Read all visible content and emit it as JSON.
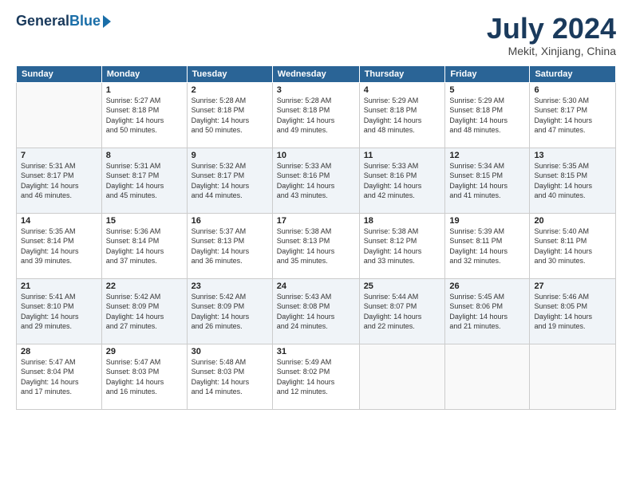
{
  "header": {
    "logo_general": "General",
    "logo_blue": "Blue",
    "month_title": "July 2024",
    "location": "Mekit, Xinjiang, China"
  },
  "weekdays": [
    "Sunday",
    "Monday",
    "Tuesday",
    "Wednesday",
    "Thursday",
    "Friday",
    "Saturday"
  ],
  "weeks": [
    [
      {
        "day": "",
        "info": ""
      },
      {
        "day": "1",
        "info": "Sunrise: 5:27 AM\nSunset: 8:18 PM\nDaylight: 14 hours\nand 50 minutes."
      },
      {
        "day": "2",
        "info": "Sunrise: 5:28 AM\nSunset: 8:18 PM\nDaylight: 14 hours\nand 50 minutes."
      },
      {
        "day": "3",
        "info": "Sunrise: 5:28 AM\nSunset: 8:18 PM\nDaylight: 14 hours\nand 49 minutes."
      },
      {
        "day": "4",
        "info": "Sunrise: 5:29 AM\nSunset: 8:18 PM\nDaylight: 14 hours\nand 48 minutes."
      },
      {
        "day": "5",
        "info": "Sunrise: 5:29 AM\nSunset: 8:18 PM\nDaylight: 14 hours\nand 48 minutes."
      },
      {
        "day": "6",
        "info": "Sunrise: 5:30 AM\nSunset: 8:17 PM\nDaylight: 14 hours\nand 47 minutes."
      }
    ],
    [
      {
        "day": "7",
        "info": "Sunrise: 5:31 AM\nSunset: 8:17 PM\nDaylight: 14 hours\nand 46 minutes."
      },
      {
        "day": "8",
        "info": "Sunrise: 5:31 AM\nSunset: 8:17 PM\nDaylight: 14 hours\nand 45 minutes."
      },
      {
        "day": "9",
        "info": "Sunrise: 5:32 AM\nSunset: 8:17 PM\nDaylight: 14 hours\nand 44 minutes."
      },
      {
        "day": "10",
        "info": "Sunrise: 5:33 AM\nSunset: 8:16 PM\nDaylight: 14 hours\nand 43 minutes."
      },
      {
        "day": "11",
        "info": "Sunrise: 5:33 AM\nSunset: 8:16 PM\nDaylight: 14 hours\nand 42 minutes."
      },
      {
        "day": "12",
        "info": "Sunrise: 5:34 AM\nSunset: 8:15 PM\nDaylight: 14 hours\nand 41 minutes."
      },
      {
        "day": "13",
        "info": "Sunrise: 5:35 AM\nSunset: 8:15 PM\nDaylight: 14 hours\nand 40 minutes."
      }
    ],
    [
      {
        "day": "14",
        "info": "Sunrise: 5:35 AM\nSunset: 8:14 PM\nDaylight: 14 hours\nand 39 minutes."
      },
      {
        "day": "15",
        "info": "Sunrise: 5:36 AM\nSunset: 8:14 PM\nDaylight: 14 hours\nand 37 minutes."
      },
      {
        "day": "16",
        "info": "Sunrise: 5:37 AM\nSunset: 8:13 PM\nDaylight: 14 hours\nand 36 minutes."
      },
      {
        "day": "17",
        "info": "Sunrise: 5:38 AM\nSunset: 8:13 PM\nDaylight: 14 hours\nand 35 minutes."
      },
      {
        "day": "18",
        "info": "Sunrise: 5:38 AM\nSunset: 8:12 PM\nDaylight: 14 hours\nand 33 minutes."
      },
      {
        "day": "19",
        "info": "Sunrise: 5:39 AM\nSunset: 8:11 PM\nDaylight: 14 hours\nand 32 minutes."
      },
      {
        "day": "20",
        "info": "Sunrise: 5:40 AM\nSunset: 8:11 PM\nDaylight: 14 hours\nand 30 minutes."
      }
    ],
    [
      {
        "day": "21",
        "info": "Sunrise: 5:41 AM\nSunset: 8:10 PM\nDaylight: 14 hours\nand 29 minutes."
      },
      {
        "day": "22",
        "info": "Sunrise: 5:42 AM\nSunset: 8:09 PM\nDaylight: 14 hours\nand 27 minutes."
      },
      {
        "day": "23",
        "info": "Sunrise: 5:42 AM\nSunset: 8:09 PM\nDaylight: 14 hours\nand 26 minutes."
      },
      {
        "day": "24",
        "info": "Sunrise: 5:43 AM\nSunset: 8:08 PM\nDaylight: 14 hours\nand 24 minutes."
      },
      {
        "day": "25",
        "info": "Sunrise: 5:44 AM\nSunset: 8:07 PM\nDaylight: 14 hours\nand 22 minutes."
      },
      {
        "day": "26",
        "info": "Sunrise: 5:45 AM\nSunset: 8:06 PM\nDaylight: 14 hours\nand 21 minutes."
      },
      {
        "day": "27",
        "info": "Sunrise: 5:46 AM\nSunset: 8:05 PM\nDaylight: 14 hours\nand 19 minutes."
      }
    ],
    [
      {
        "day": "28",
        "info": "Sunrise: 5:47 AM\nSunset: 8:04 PM\nDaylight: 14 hours\nand 17 minutes."
      },
      {
        "day": "29",
        "info": "Sunrise: 5:47 AM\nSunset: 8:03 PM\nDaylight: 14 hours\nand 16 minutes."
      },
      {
        "day": "30",
        "info": "Sunrise: 5:48 AM\nSunset: 8:03 PM\nDaylight: 14 hours\nand 14 minutes."
      },
      {
        "day": "31",
        "info": "Sunrise: 5:49 AM\nSunset: 8:02 PM\nDaylight: 14 hours\nand 12 minutes."
      },
      {
        "day": "",
        "info": ""
      },
      {
        "day": "",
        "info": ""
      },
      {
        "day": "",
        "info": ""
      }
    ]
  ]
}
